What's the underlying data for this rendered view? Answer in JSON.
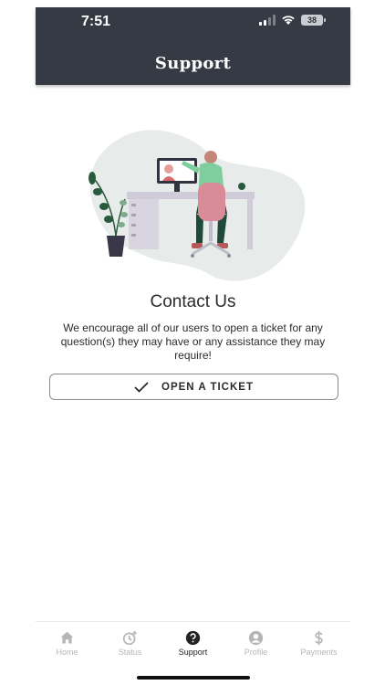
{
  "status_bar": {
    "time": "7:51",
    "battery": "38"
  },
  "header": {
    "title": "Support"
  },
  "contact": {
    "title": "Contact Us",
    "description": "We encourage all of our users to open a ticket for any question(s) they may have or any assistance they may require!"
  },
  "ticket_button": {
    "label": "OPEN A TICKET",
    "icon": "checkmark-icon"
  },
  "tabs": [
    {
      "label": "Home",
      "icon": "home-icon",
      "active": false
    },
    {
      "label": "Status",
      "icon": "clock-plus-icon",
      "active": false
    },
    {
      "label": "Support",
      "icon": "help-circle-icon",
      "active": true
    },
    {
      "label": "Profile",
      "icon": "user-circle-icon",
      "active": false
    },
    {
      "label": "Payments",
      "icon": "dollar-icon",
      "active": false
    }
  ],
  "colors": {
    "header_bg": "#363a45",
    "active_tab": "#222222",
    "inactive_tab": "#b6b6b6"
  }
}
